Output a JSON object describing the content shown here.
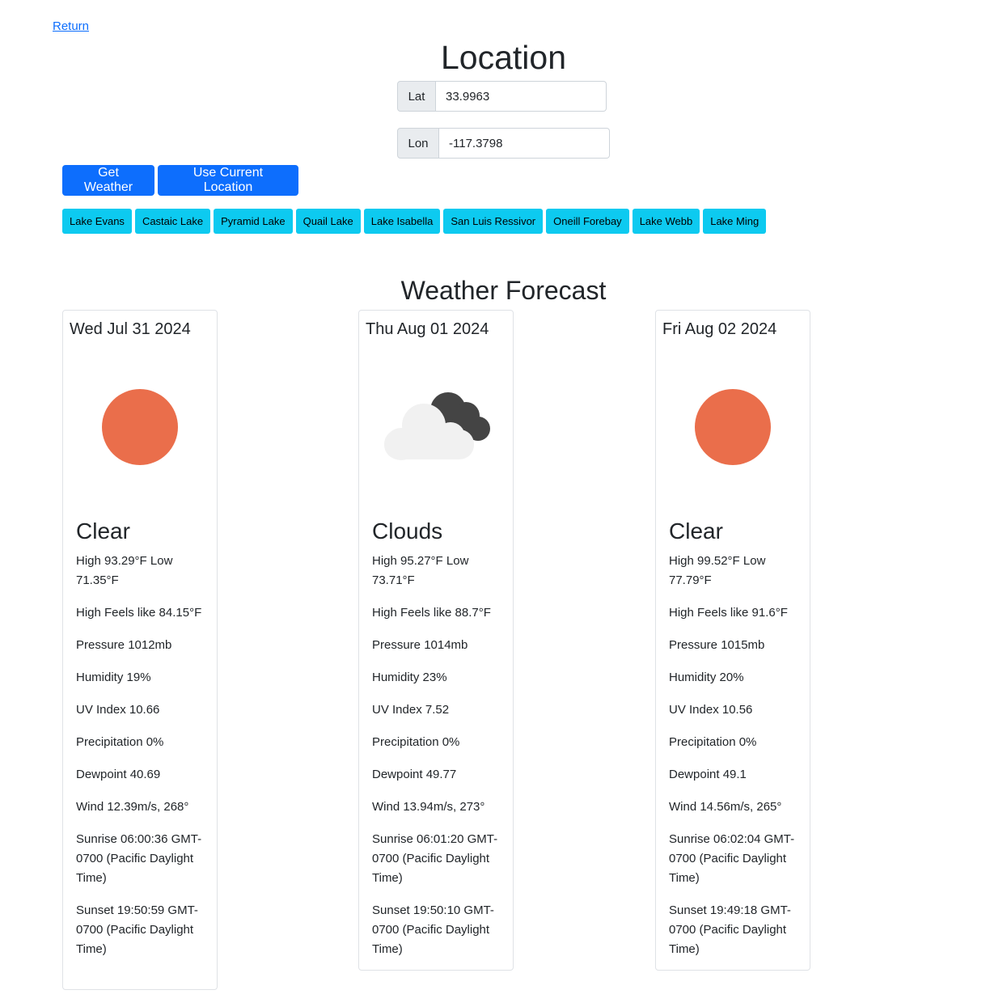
{
  "nav": {
    "return_label": "Return"
  },
  "location": {
    "title": "Location",
    "lat_label": "Lat",
    "lat_value": "33.9963",
    "lon_label": "Lon",
    "lon_value": "-117.3798"
  },
  "actions": {
    "get_weather": "Get Weather",
    "use_current_location": "Use Current Location"
  },
  "lakes": [
    "Lake Evans",
    "Castaic Lake",
    "Pyramid Lake",
    "Quail Lake",
    "Lake Isabella",
    "San Luis Ressivor",
    "Oneill Forebay",
    "Lake Webb",
    "Lake Ming"
  ],
  "forecast": {
    "title": "Weather Forecast",
    "days": [
      {
        "date": "Wed Jul 31 2024",
        "icon": "sun-icon",
        "condition": "Clear",
        "high_low": "High 93.29°F Low 71.35°F",
        "feels_like": "High Feels like 84.15°F",
        "pressure": "Pressure 1012mb",
        "humidity": "Humidity 19%",
        "uv": "UV Index 10.66",
        "precip": "Precipitation 0%",
        "dewpoint": "Dewpoint 40.69",
        "wind": "Wind 12.39m/s, 268°",
        "sunrise": "Sunrise 06:00:36 GMT-0700 (Pacific Daylight Time)",
        "sunset": "Sunset 19:50:59 GMT-0700 (Pacific Daylight Time)"
      },
      {
        "date": "Thu Aug 01 2024",
        "icon": "cloud-icon",
        "condition": "Clouds",
        "high_low": "High 95.27°F Low 73.71°F",
        "feels_like": "High Feels like 88.7°F",
        "pressure": "Pressure 1014mb",
        "humidity": "Humidity 23%",
        "uv": "UV Index 7.52",
        "precip": "Precipitation 0%",
        "dewpoint": "Dewpoint 49.77",
        "wind": "Wind 13.94m/s, 273°",
        "sunrise": "Sunrise 06:01:20 GMT-0700 (Pacific Daylight Time)",
        "sunset": "Sunset 19:50:10 GMT-0700 (Pacific Daylight Time)"
      },
      {
        "date": "Fri Aug 02 2024",
        "icon": "sun-icon",
        "condition": "Clear",
        "high_low": "High 99.52°F Low 77.79°F",
        "feels_like": "High Feels like 91.6°F",
        "pressure": "Pressure 1015mb",
        "humidity": "Humidity 20%",
        "uv": "UV Index 10.56",
        "precip": "Precipitation 0%",
        "dewpoint": "Dewpoint 49.1",
        "wind": "Wind 14.56m/s, 265°",
        "sunrise": "Sunrise 06:02:04 GMT-0700 (Pacific Daylight Time)",
        "sunset": "Sunset 19:49:18 GMT-0700 (Pacific Daylight Time)"
      }
    ]
  },
  "colors": {
    "primary": "#0d6efd",
    "info": "#0dcaf0",
    "sun": "#ea6e4b",
    "cloud_light": "#f1f1f1",
    "cloud_dark": "#444444"
  }
}
